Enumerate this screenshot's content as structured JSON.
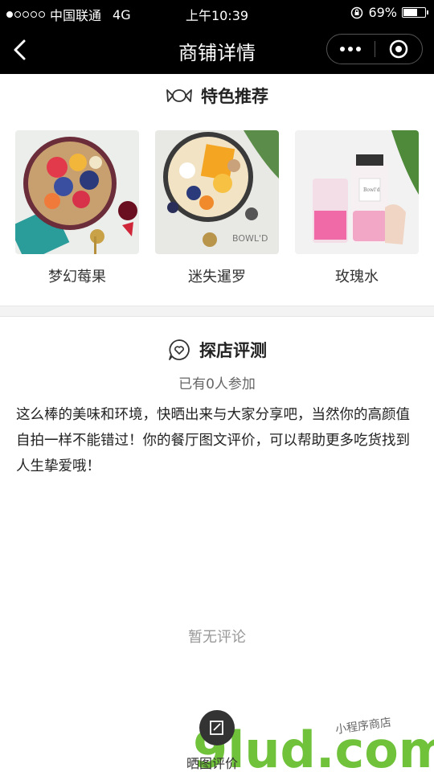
{
  "status_bar": {
    "carrier": "中国联通",
    "network": "4G",
    "time": "上午10:39",
    "battery": "69%",
    "battery_level": 0.69
  },
  "nav": {
    "title": "商铺详情"
  },
  "featured": {
    "title": "特色推荐",
    "items": [
      {
        "name": "梦幻莓果"
      },
      {
        "name": "迷失暹罗"
      },
      {
        "name": "玫瑰水"
      }
    ]
  },
  "review": {
    "title": "探店评测",
    "participants": "已有0人参加",
    "description": "这么棒的美味和环境，快晒出来与大家分享吧，当然你的高颜值自拍一样不能错过！你的餐厅图文评价，可以帮助更多吃货找到人生挚爱哦！",
    "empty": "暂无评论",
    "post_label": "晒图评价"
  },
  "watermark": {
    "brand": "9lud.com",
    "tagline": "小程序商店"
  }
}
